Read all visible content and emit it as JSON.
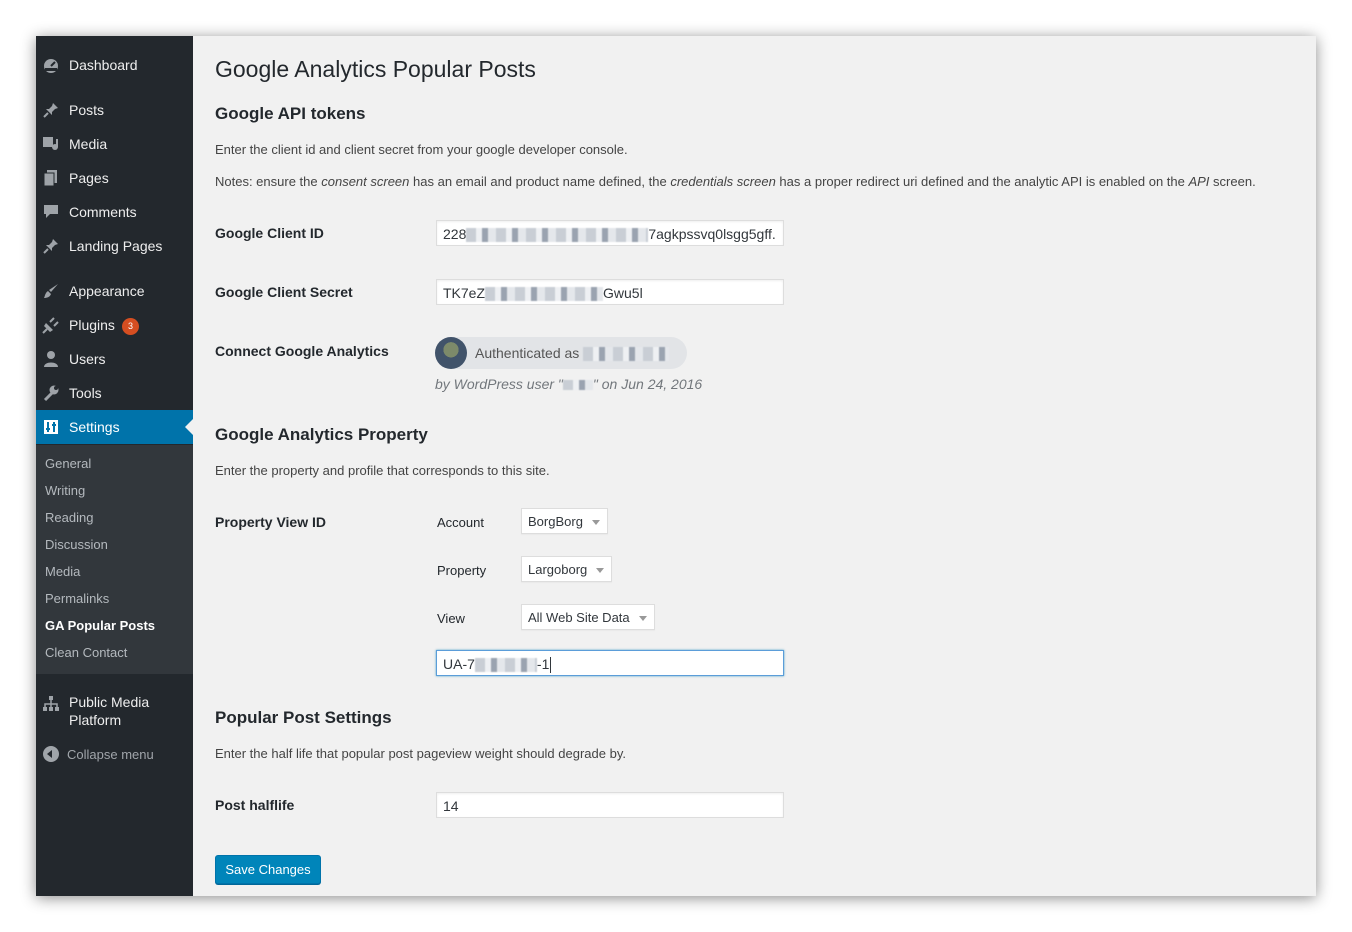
{
  "sidebar": {
    "items": [
      {
        "label": "Dashboard",
        "icon": "dashboard-icon"
      },
      {
        "label": "Posts",
        "icon": "pin-icon"
      },
      {
        "label": "Media",
        "icon": "media-icon"
      },
      {
        "label": "Pages",
        "icon": "pages-icon"
      },
      {
        "label": "Comments",
        "icon": "comments-icon"
      },
      {
        "label": "Landing Pages",
        "icon": "pin-icon"
      },
      {
        "label": "Appearance",
        "icon": "brush-icon"
      },
      {
        "label": "Plugins",
        "icon": "plugin-icon",
        "badge": "3"
      },
      {
        "label": "Users",
        "icon": "user-icon"
      },
      {
        "label": "Tools",
        "icon": "wrench-icon"
      },
      {
        "label": "Settings",
        "icon": "settings-icon"
      },
      {
        "label": "Public Media",
        "label2": "Platform",
        "icon": "network-icon"
      }
    ],
    "submenu": [
      "General",
      "Writing",
      "Reading",
      "Discussion",
      "Media",
      "Permalinks",
      "GA Popular Posts",
      "Clean Contact"
    ],
    "collapse_label": "Collapse menu"
  },
  "page": {
    "title": "Google Analytics Popular Posts",
    "tokens_heading": "Google API tokens",
    "tokens_desc": "Enter the client id and client secret from your google developer console.",
    "notes": {
      "p1": "Notes: ensure the ",
      "e1": "consent screen",
      "p2": " has an email and product name defined, the ",
      "e2": "credentials screen",
      "p3": " has a proper redirect uri defined and the analytic API is enabled on the ",
      "e3": "API",
      "p4": " screen."
    },
    "client_id_label": "Google Client ID",
    "client_id_prefix": "228",
    "client_id_suffix": "7agkpssvq0lsgg5gff.",
    "client_secret_label": "Google Client Secret",
    "client_secret_prefix": "TK7eZ",
    "client_secret_suffix": "Gwu5l",
    "connect_label": "Connect Google Analytics",
    "auth_text": "Authenticated as",
    "byline_prefix": "by WordPress user \"",
    "byline_suffix": "\" on Jun 24, 2016",
    "property_heading": "Google Analytics Property",
    "property_desc": "Enter the property and profile that corresponds to this site.",
    "property_view_label": "Property View ID",
    "account_label": "Account",
    "account_value": "BorgBorg",
    "property_label": "Property",
    "property_value": "Largoborg",
    "view_label": "View",
    "view_value": "All Web Site Data",
    "ua_prefix": "UA-7",
    "ua_suffix": "-1",
    "popular_heading": "Popular Post Settings",
    "popular_desc": "Enter the half life that popular post pageview weight should degrade by.",
    "halflife_label": "Post halflife",
    "halflife_value": "14",
    "save_label": "Save Changes"
  },
  "colors": {
    "sidebar_bg": "#23282d",
    "submenu_bg": "#32373c",
    "active_bg": "#0073aa",
    "button_bg": "#0085ba",
    "badge_bg": "#d54e21"
  }
}
